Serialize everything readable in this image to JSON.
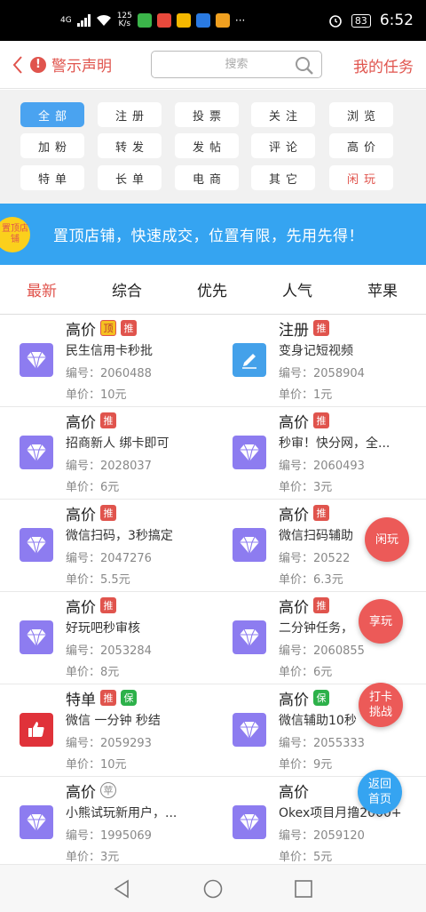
{
  "status_bar": {
    "network": "4G",
    "speed_value": "125",
    "speed_unit": "K/s",
    "battery": "83",
    "time": "6:52",
    "more": "···"
  },
  "header": {
    "back_icon": "chevron-left-icon",
    "warning_label": "警示声明",
    "search_placeholder": "搜索",
    "my_tasks_label": "我的任务"
  },
  "categories": [
    "全部",
    "注册",
    "投票",
    "关注",
    "浏览",
    "加粉",
    "转发",
    "发帖",
    "评论",
    "高价",
    "特单",
    "长单",
    "电商",
    "其它",
    "闲玩"
  ],
  "banner": {
    "badge": "置顶店铺",
    "text": "置顶店铺，快速成交，位置有限，先用先得！"
  },
  "tabs": [
    "最新",
    "综合",
    "优先",
    "人气",
    "苹果"
  ],
  "labels": {
    "id_prefix": "编号：",
    "price_prefix": "单价：",
    "tag_recommend": "推",
    "tag_top": "顶",
    "tag_guarantee": "保",
    "tag_ping": "苹"
  },
  "tasks": [
    {
      "type": "高价",
      "tags": [
        "顶",
        "推"
      ],
      "desc": "民生信用卡秒批",
      "id": "2060488",
      "price": "10元",
      "icon": "diamond-icon"
    },
    {
      "type": "注册",
      "tags": [
        "推"
      ],
      "desc": "变身记短视频",
      "id": "2058904",
      "price": "1元",
      "icon": "pencil-icon"
    },
    {
      "type": "高价",
      "tags": [
        "推"
      ],
      "desc": "招商新人 绑卡即可",
      "id": "2028037",
      "price": "6元",
      "icon": "diamond-icon"
    },
    {
      "type": "高价",
      "tags": [
        "推"
      ],
      "desc": "秒审！快分网，全...",
      "id": "2060493",
      "price": "3元",
      "icon": "diamond-icon"
    },
    {
      "type": "高价",
      "tags": [
        "推"
      ],
      "desc": "微信扫码，3秒搞定",
      "id": "2047276",
      "price": "5.5元",
      "icon": "diamond-icon"
    },
    {
      "type": "高价",
      "tags": [
        "推"
      ],
      "desc": "微信扫码辅助",
      "id": "20522",
      "price": "6.3元",
      "icon": "diamond-icon"
    },
    {
      "type": "高价",
      "tags": [
        "推"
      ],
      "desc": "好玩吧秒审核",
      "id": "2053284",
      "price": "8元",
      "icon": "diamond-icon"
    },
    {
      "type": "高价",
      "tags": [
        "推"
      ],
      "desc": "二分钟任务，",
      "id": "2060855",
      "price": "6元",
      "icon": "diamond-icon"
    },
    {
      "type": "特单",
      "tags": [
        "推",
        "保"
      ],
      "desc": "微信 一分钟 秒结",
      "id": "2059293",
      "price": "10元",
      "icon": "thumbs-up-icon"
    },
    {
      "type": "高价",
      "tags": [
        "保"
      ],
      "desc": "微信辅助10秒",
      "id": "2055333",
      "price": "9元",
      "icon": "diamond-icon"
    },
    {
      "type": "高价",
      "tags": [
        "苹"
      ],
      "desc": "小熊试玩新用户，...",
      "id": "1995069",
      "price": "3元",
      "icon": "diamond-icon"
    },
    {
      "type": "高价",
      "tags": [],
      "desc": "Okex项目月撸2000+",
      "id": "2059120",
      "price": "5元",
      "icon": "diamond-icon"
    }
  ],
  "floating": {
    "play": "闲玩",
    "enjoy": "享玩",
    "checkin_line1": "打卡",
    "checkin_line2": "挑战",
    "home_line1": "返回",
    "home_line2": "首页"
  },
  "colors": {
    "accent_red": "#e0544d",
    "accent_blue": "#35a4f1",
    "diamond_purple": "#8d7cf0",
    "pencil_blue": "#44a1ea",
    "thumb_red": "#e0323a"
  }
}
